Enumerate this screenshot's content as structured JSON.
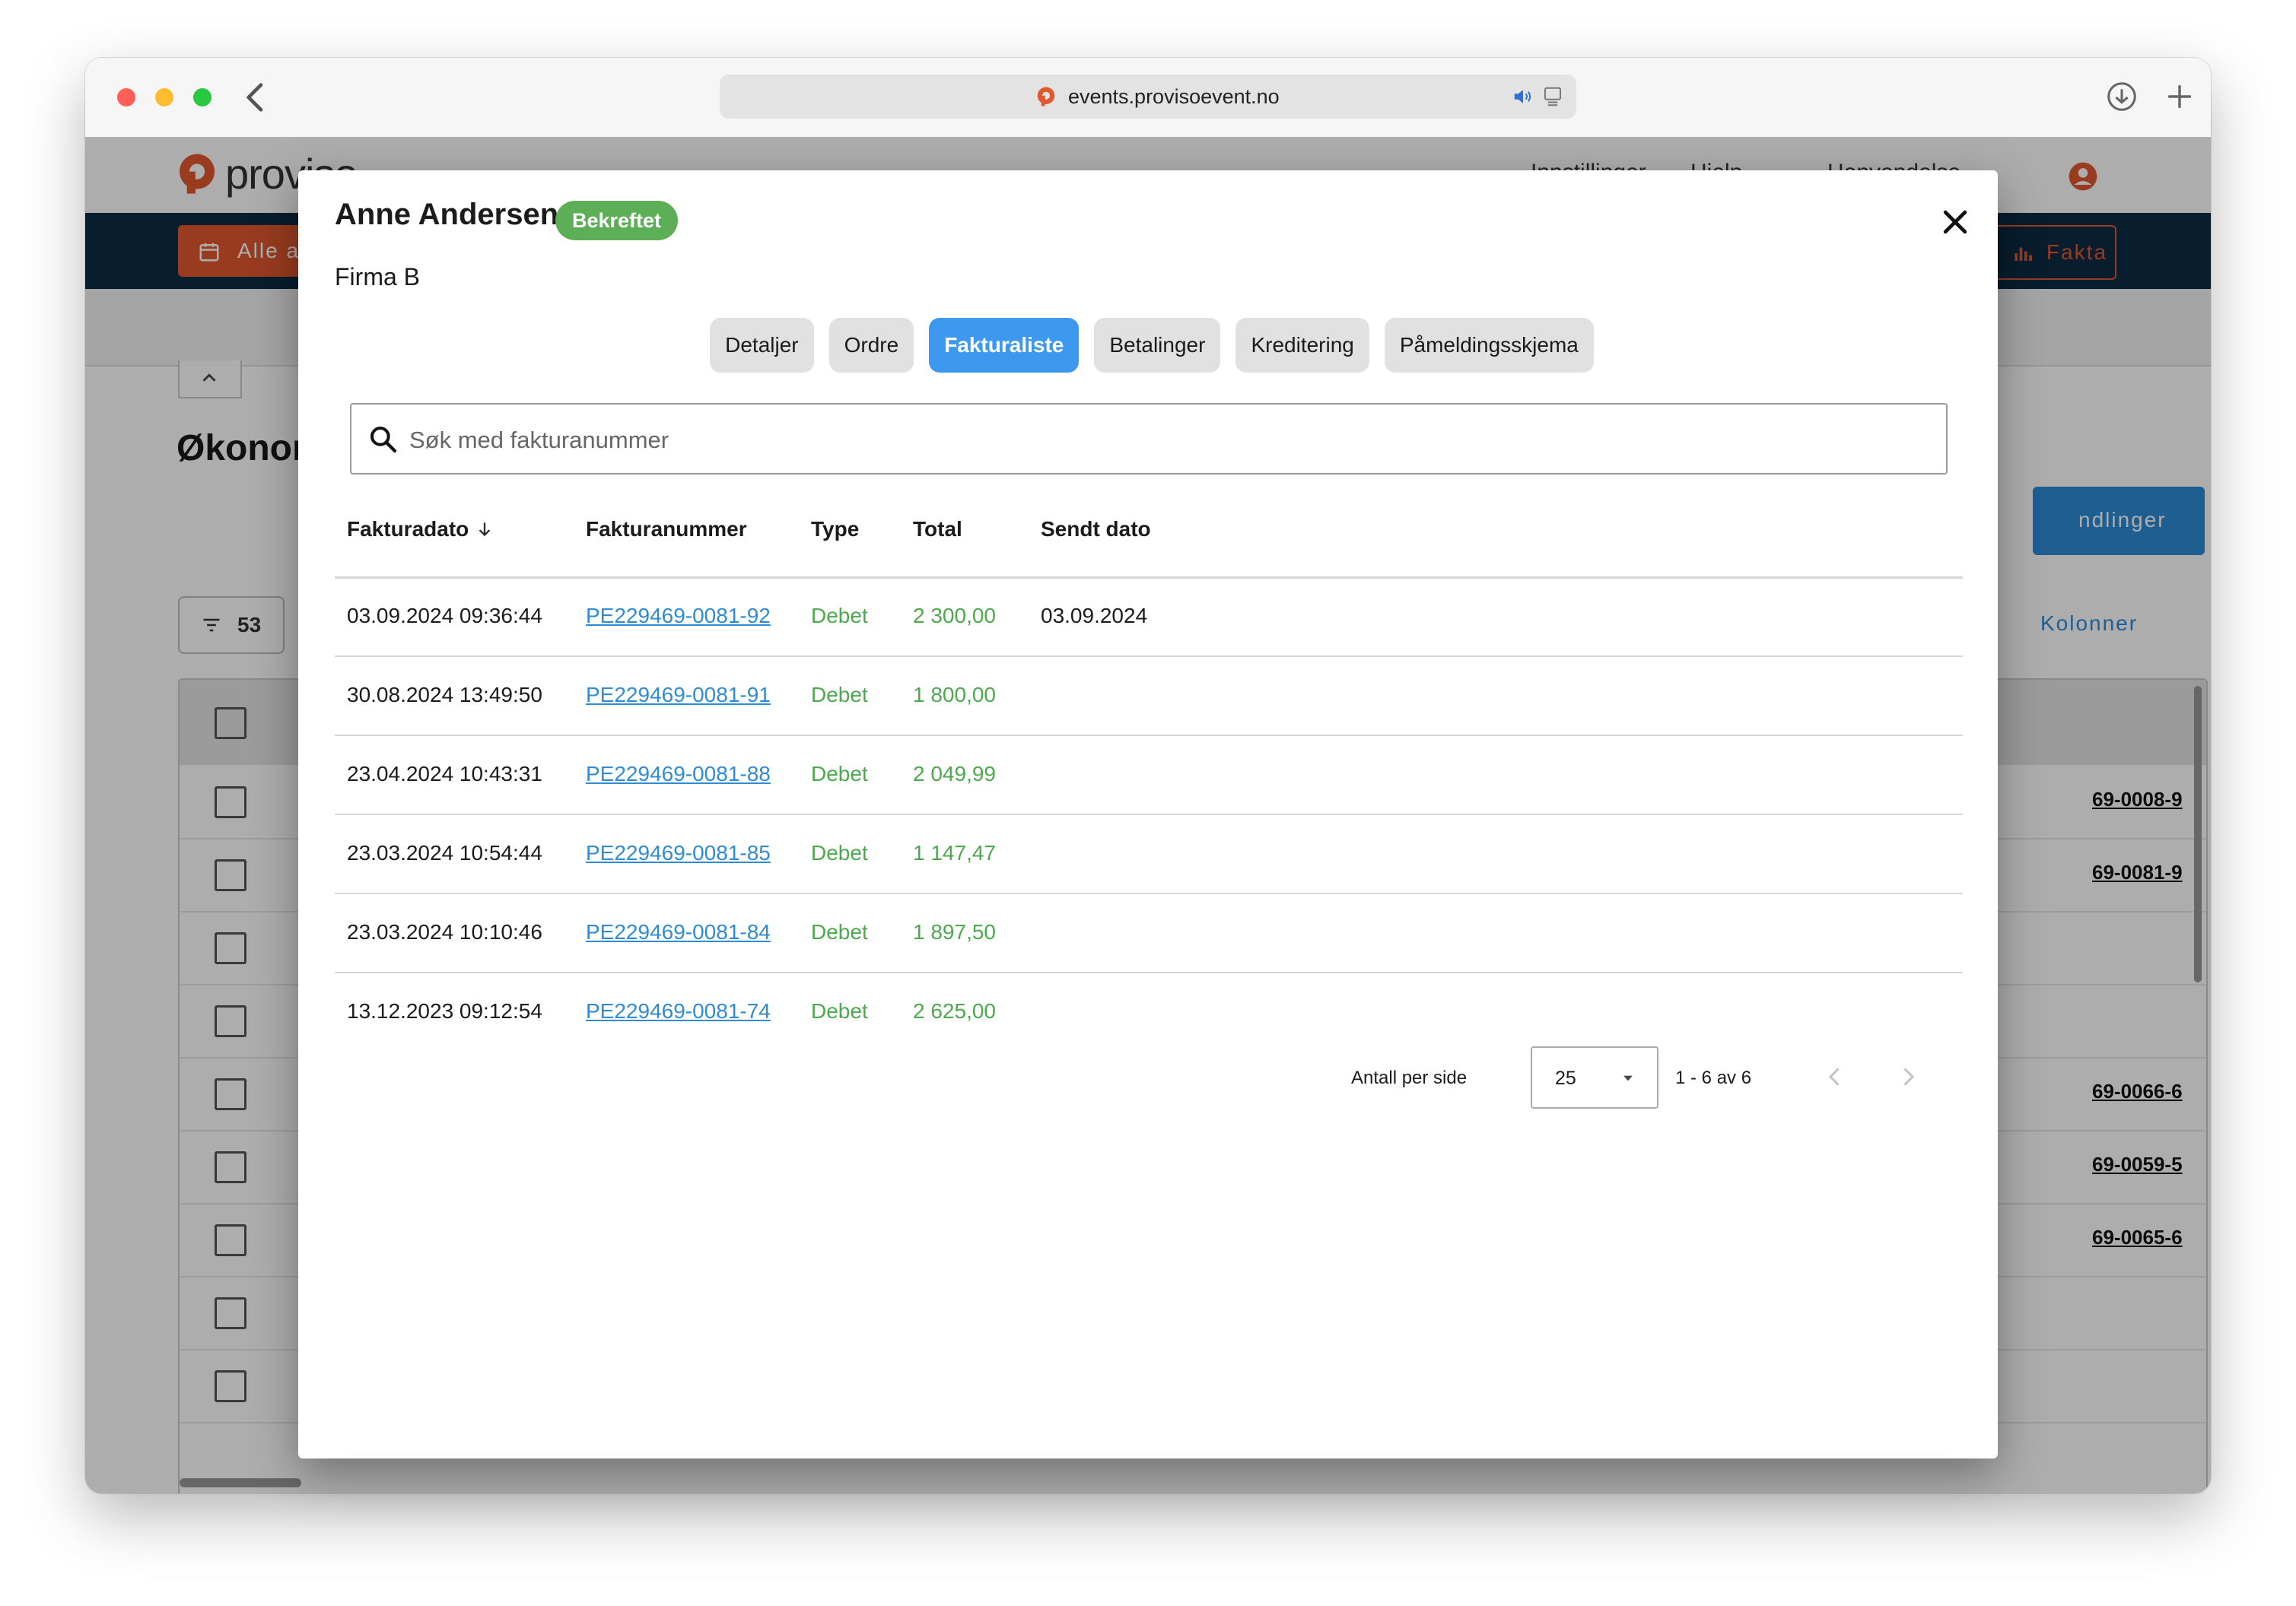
{
  "browser": {
    "url": "events.provisoevent.no"
  },
  "app": {
    "logo_text": "proviso",
    "header_items": [
      "Innstillinger",
      "Hjelp",
      "Henvendelse"
    ],
    "nav_left_label": "Alle ar",
    "nav_right_label": "Fakta",
    "page_heading": "Økonor",
    "primary_button_label": "ndlinger",
    "filter_count": "53",
    "columns_link": "Kolonner",
    "bg_refs": [
      "69-0008-9",
      "69-0081-9",
      "69-0066-6",
      "69-0059-5",
      "69-0065-6"
    ]
  },
  "modal": {
    "name": "Anne Andersen",
    "status_badge": "Bekreftet",
    "company": "Firma B",
    "tabs": [
      {
        "label": "Detaljer",
        "active": false
      },
      {
        "label": "Ordre",
        "active": false
      },
      {
        "label": "Fakturaliste",
        "active": true
      },
      {
        "label": "Betalinger",
        "active": false
      },
      {
        "label": "Kreditering",
        "active": false
      },
      {
        "label": "Påmeldingsskjema",
        "active": false
      }
    ],
    "search": {
      "placeholder": "Søk med fakturanummer",
      "value": ""
    },
    "table": {
      "headers": {
        "date": "Fakturadato",
        "number": "Fakturanummer",
        "type": "Type",
        "total": "Total",
        "sent": "Sendt dato"
      },
      "rows": [
        {
          "date": "03.09.2024 09:36:44",
          "number": "PE229469-0081-92",
          "type": "Debet",
          "total": "2 300,00",
          "sent": "03.09.2024"
        },
        {
          "date": "30.08.2024 13:49:50",
          "number": "PE229469-0081-91",
          "type": "Debet",
          "total": "1 800,00",
          "sent": ""
        },
        {
          "date": "23.04.2024 10:43:31",
          "number": "PE229469-0081-88",
          "type": "Debet",
          "total": "2 049,99",
          "sent": ""
        },
        {
          "date": "23.03.2024 10:54:44",
          "number": "PE229469-0081-85",
          "type": "Debet",
          "total": "1 147,47",
          "sent": ""
        },
        {
          "date": "23.03.2024 10:10:46",
          "number": "PE229469-0081-84",
          "type": "Debet",
          "total": "1 897,50",
          "sent": ""
        },
        {
          "date": "13.12.2023 09:12:54",
          "number": "PE229469-0081-74",
          "type": "Debet",
          "total": "2 625,00",
          "sent": ""
        }
      ]
    },
    "pagination": {
      "per_page_label": "Antall per side",
      "per_page_value": "25",
      "range": "1 - 6 av 6"
    }
  },
  "colors": {
    "accent_blue": "#3d99f0",
    "link_blue": "#2f8bd6",
    "success_green": "#5caf56",
    "amount_green": "#4caa4d",
    "brand_orange": "#e1582f",
    "nav_dark": "#0d2b45"
  }
}
